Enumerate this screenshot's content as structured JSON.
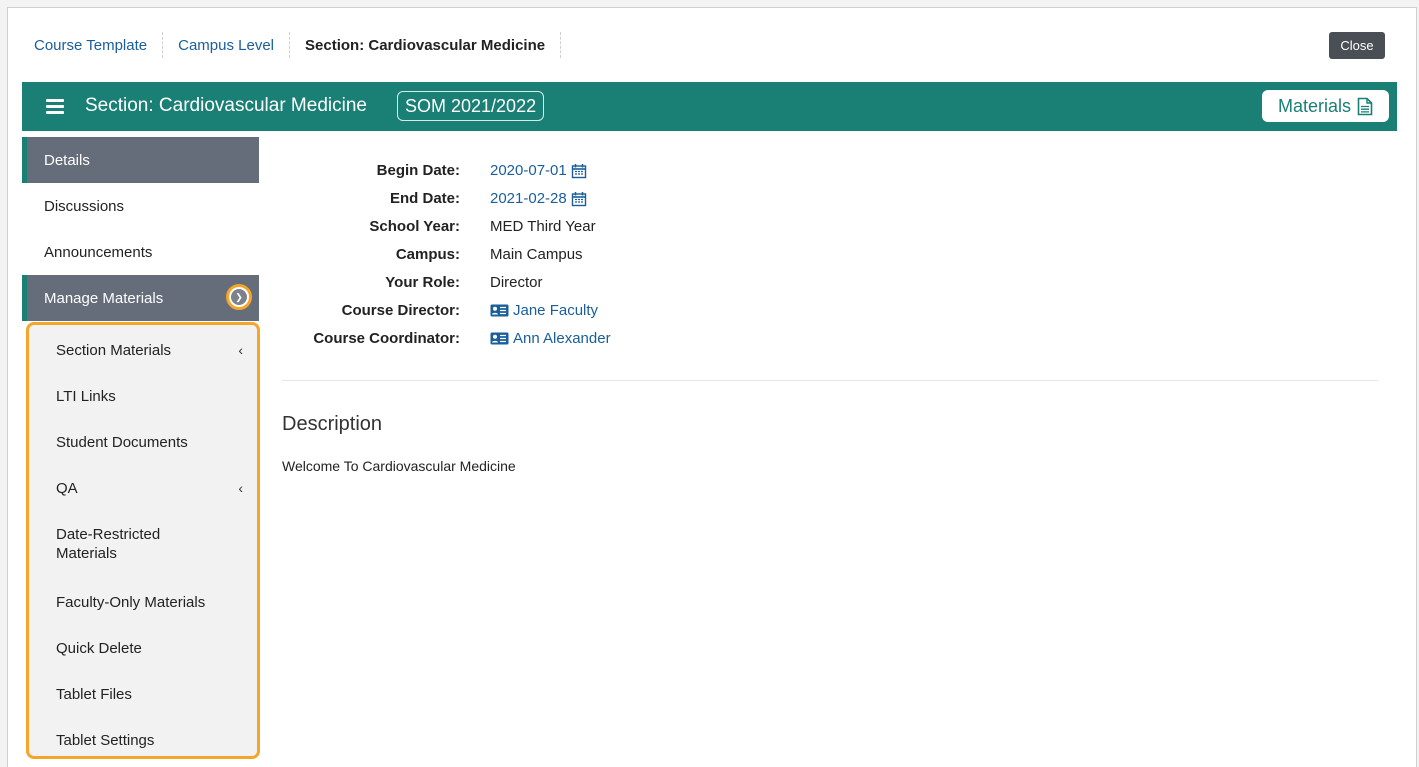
{
  "breadcrumb": {
    "items": [
      "Course Template",
      "Campus Level",
      "Section: Cardiovascular Medicine"
    ]
  },
  "close_label": "Close",
  "header": {
    "title": "Section: Cardiovascular Medicine",
    "badge": "SOM 2021/2022",
    "materials_label": "Materials"
  },
  "sidebar": {
    "items": [
      "Details",
      "Discussions",
      "Announcements",
      "Manage Materials"
    ],
    "submenu": [
      "Section Materials",
      "LTI Links",
      "Student Documents",
      "QA",
      "Date-Restricted Materials",
      "Faculty-Only Materials",
      "Quick Delete",
      "Tablet Files",
      "Tablet Settings"
    ]
  },
  "details": {
    "begin_date_label": "Begin Date:",
    "begin_date": "2020-07-01",
    "end_date_label": "End Date:",
    "end_date": "2021-02-28",
    "school_year_label": "School Year:",
    "school_year": "MED Third Year",
    "campus_label": "Campus:",
    "campus": "Main Campus",
    "role_label": "Your Role:",
    "role": "Director",
    "director_label": "Course Director:",
    "director": "Jane Faculty",
    "coordinator_label": "Course Coordinator:",
    "coordinator": "Ann Alexander"
  },
  "description": {
    "heading": "Description",
    "text": "Welcome To Cardiovascular Medicine"
  },
  "colors": {
    "teal": "#1a7f74",
    "highlight": "#f4a52a",
    "active_nav": "#656c7a",
    "link": "#1a5e9a"
  }
}
